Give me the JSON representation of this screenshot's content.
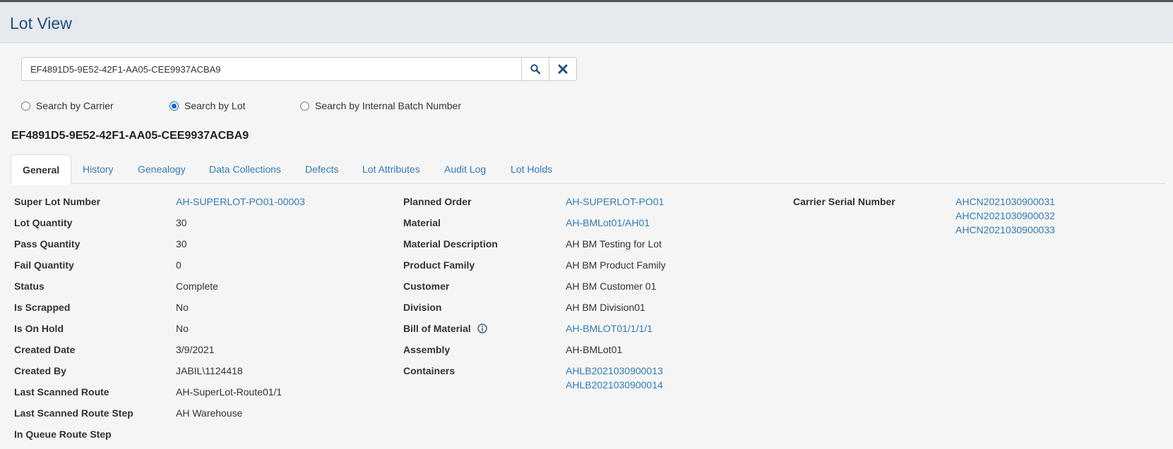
{
  "page": {
    "title": "Lot View"
  },
  "search": {
    "value": "EF4891D5-9E52-42F1-AA05-CEE9937ACBA9",
    "icon": "search-icon",
    "clear_icon": "close-icon"
  },
  "search_options": [
    {
      "label": "Search by Carrier",
      "checked": false
    },
    {
      "label": "Search by Lot",
      "checked": true
    },
    {
      "label": "Search by Internal Batch Number",
      "checked": false
    }
  ],
  "lot": {
    "id": "EF4891D5-9E52-42F1-AA05-CEE9937ACBA9"
  },
  "tabs": [
    {
      "label": "General",
      "active": true
    },
    {
      "label": "History"
    },
    {
      "label": "Genealogy"
    },
    {
      "label": "Data Collections"
    },
    {
      "label": "Defects"
    },
    {
      "label": "Lot Attributes"
    },
    {
      "label": "Audit Log"
    },
    {
      "label": "Lot Holds"
    }
  ],
  "general": {
    "col1": [
      {
        "label": "Super Lot Number",
        "value": "AH-SUPERLOT-PO01-00003",
        "link": true
      },
      {
        "label": "Lot Quantity",
        "value": "30"
      },
      {
        "label": "Pass Quantity",
        "value": "30"
      },
      {
        "label": "Fail Quantity",
        "value": "0"
      },
      {
        "label": "Status",
        "value": "Complete"
      },
      {
        "label": "Is Scrapped",
        "value": "No"
      },
      {
        "label": "Is On Hold",
        "value": "No"
      },
      {
        "label": "Created Date",
        "value": "3/9/2021"
      },
      {
        "label": "Created By",
        "value": "JABIL\\1124418"
      },
      {
        "label": "Last Scanned Route",
        "value": "AH-SuperLot-Route01/1"
      },
      {
        "label": "Last Scanned Route Step",
        "value": "AH Warehouse"
      },
      {
        "label": "In Queue Route Step",
        "value": ""
      }
    ],
    "col2": [
      {
        "label": "Planned Order",
        "value": "AH-SUPERLOT-PO01",
        "link": true
      },
      {
        "label": "Material",
        "value": "AH-BMLot01/AH01",
        "link": true
      },
      {
        "label": "Material Description",
        "value": "AH BM Testing for Lot"
      },
      {
        "label": "Product Family",
        "value": "AH BM Product Family"
      },
      {
        "label": "Customer",
        "value": "AH BM Customer 01"
      },
      {
        "label": "Division",
        "value": "AH BM Division01"
      },
      {
        "label": "Bill of Material",
        "value": "AH-BMLOT01/1/1/1",
        "link": true,
        "icon": "info-icon"
      },
      {
        "label": "Assembly",
        "value": "AH-BMLot01"
      },
      {
        "label": "Containers",
        "values": [
          "AHLB2021030900013",
          "AHLB2021030900014"
        ],
        "link": true
      }
    ],
    "col3": [
      {
        "label": "Carrier Serial Number",
        "values": [
          "AHCN2021030900031",
          "AHCN2021030900032",
          "AHCN2021030900033"
        ],
        "link": true
      }
    ]
  }
}
